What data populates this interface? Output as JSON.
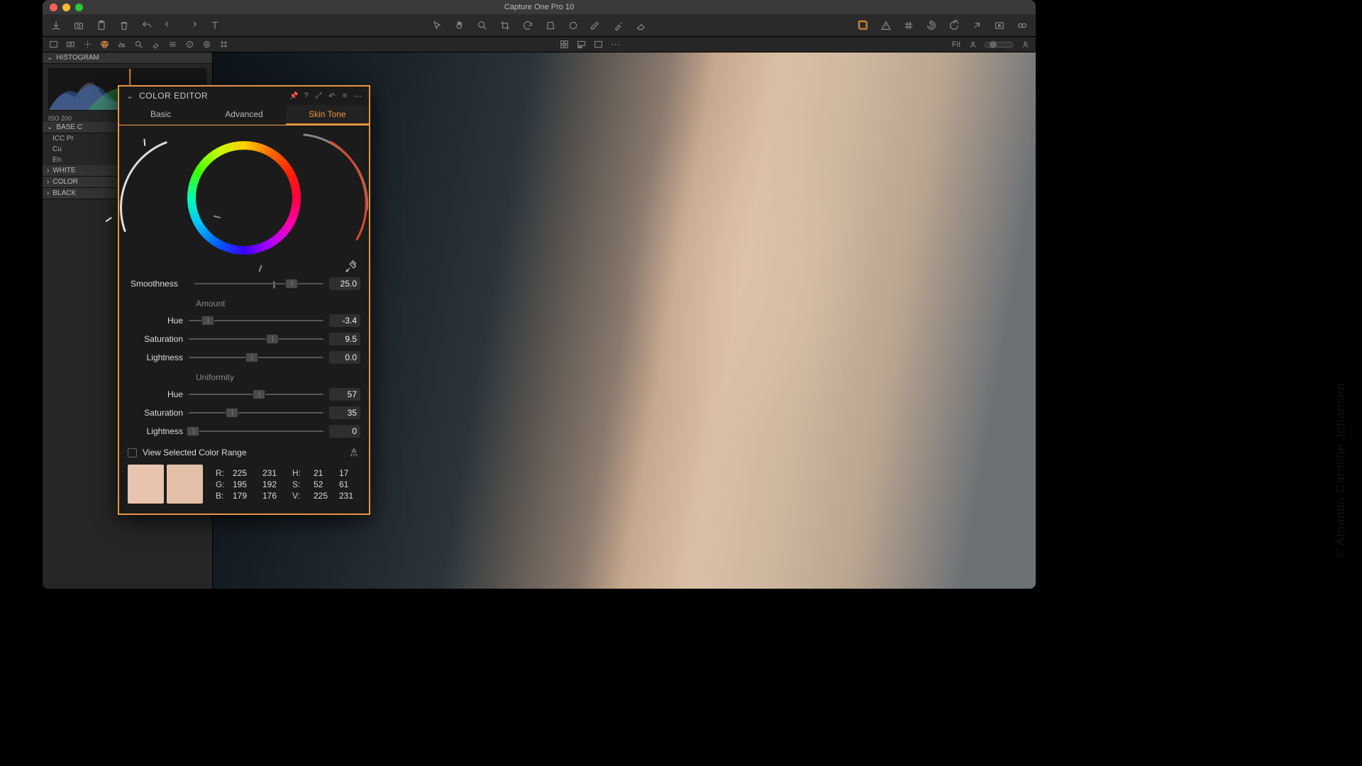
{
  "app": {
    "title": "Capture One Pro 10"
  },
  "viewer_toolbar": {
    "fit_label": "Fit"
  },
  "sidebar": {
    "histogram": {
      "title": "HISTOGRAM",
      "iso_label": "ISO 200"
    },
    "sections": {
      "base": "BASE C",
      "icc": "ICC Pr",
      "cu": "Cu",
      "en": "En",
      "white": "WHITE",
      "color": "COLOR",
      "black": "BLACK"
    }
  },
  "panel": {
    "title": "COLOR EDITOR",
    "tabs": {
      "basic": "Basic",
      "advanced": "Advanced",
      "skin": "Skin Tone"
    },
    "sliders": {
      "smoothness": {
        "label": "Smoothness",
        "value": "25.0",
        "pos": 75
      },
      "amount_group": "Amount",
      "amount_hue": {
        "label": "Hue",
        "value": "-3.4",
        "pos": 14
      },
      "amount_sat": {
        "label": "Saturation",
        "value": "9.5",
        "pos": 62
      },
      "amount_lig": {
        "label": "Lightness",
        "value": "0.0",
        "pos": 47
      },
      "uniformity_group": "Uniformity",
      "uni_hue": {
        "label": "Hue",
        "value": "57",
        "pos": 52
      },
      "uni_sat": {
        "label": "Saturation",
        "value": "35",
        "pos": 32
      },
      "uni_lig": {
        "label": "Lightness",
        "value": "0",
        "pos": 3
      }
    },
    "view_range": "View Selected Color Range",
    "swatch_colors": {
      "a": "#e8c4ae",
      "b": "#e4bfa8"
    },
    "readout": {
      "R": [
        "225",
        "231"
      ],
      "H": [
        "21",
        "17"
      ],
      "G": [
        "195",
        "192"
      ],
      "S": [
        "52",
        "61"
      ],
      "B": [
        "179",
        "176"
      ],
      "V": [
        "225",
        "231"
      ]
    }
  },
  "credit": "© Amanda Caroline Johansen"
}
